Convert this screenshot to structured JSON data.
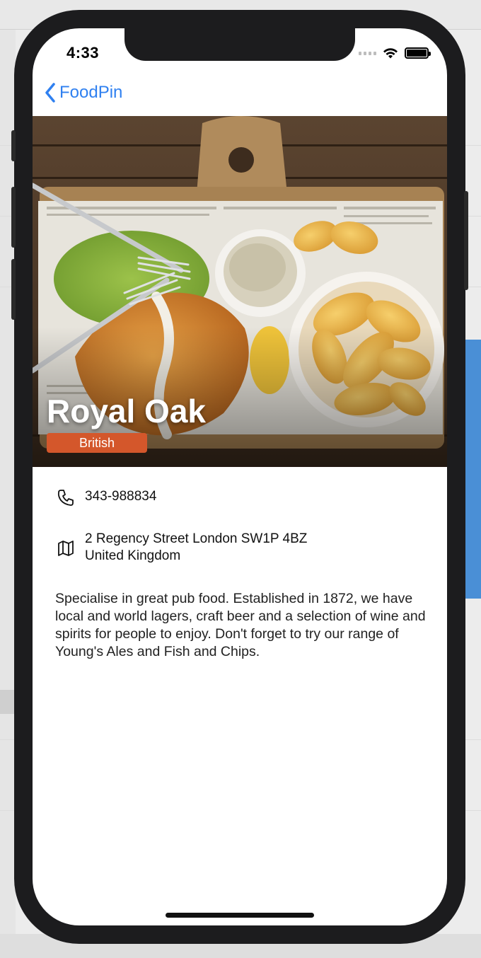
{
  "status_bar": {
    "time": "4:33"
  },
  "nav": {
    "back_label": "FoodPin"
  },
  "restaurant": {
    "name": "Royal Oak",
    "type": "British",
    "phone": "343-988834",
    "address_line1": "2 Regency Street London SW1P 4BZ",
    "address_line2": "United Kingdom",
    "description": "Specialise in great pub food. Established in 1872, we have local and world lagers, craft beer and a selection of wine and spirits for people to enjoy. Don't forget to try our range of Young's Ales and Fish and Chips."
  },
  "colors": {
    "accent": "#2f80f0",
    "tag": "#d4572b"
  },
  "icons": [
    "chevron-left-icon",
    "phone-icon",
    "map-icon",
    "wifi-icon",
    "battery-icon",
    "signal-icon"
  ]
}
